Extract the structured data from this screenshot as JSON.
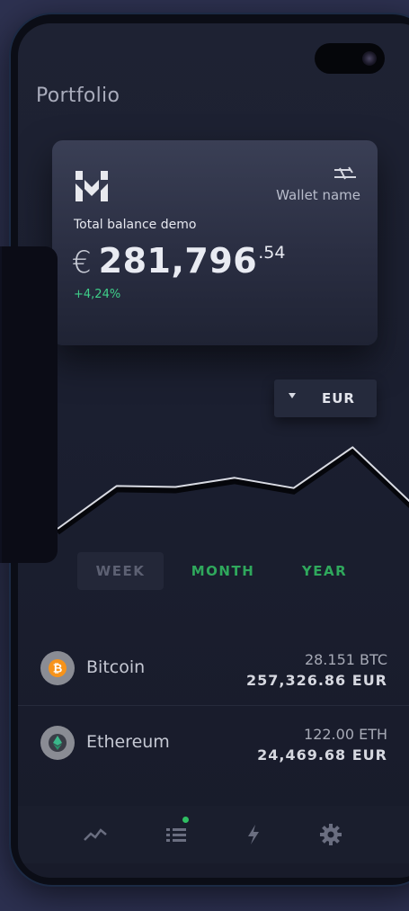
{
  "page": {
    "title": "Portfolio"
  },
  "wallet": {
    "name": "Wallet name",
    "balance_label": "Total balance demo",
    "currency_symbol": "€",
    "balance_main": "281,796",
    "balance_cents": ".54",
    "change": "+4,24%"
  },
  "currency_selector": {
    "value": "EUR"
  },
  "chart_data": {
    "type": "line",
    "x": [
      0,
      1,
      2,
      3,
      4,
      5,
      6
    ],
    "values": [
      0,
      42,
      41,
      50,
      40,
      80,
      25
    ],
    "ylim": [
      0,
      90
    ],
    "color": "#d9dbe3"
  },
  "period_tabs": [
    {
      "label": "WEEK",
      "selected": true
    },
    {
      "label": "MONTH",
      "selected": false
    },
    {
      "label": "YEAR",
      "selected": false
    }
  ],
  "assets": [
    {
      "name": "Bitcoin",
      "amount": "28.151 BTC",
      "value": "257,326.86 EUR",
      "icon": "bitcoin-icon"
    },
    {
      "name": "Ethereum",
      "amount": "122.00 ETH",
      "value": "24,469.68 EUR",
      "icon": "ethereum-icon"
    }
  ],
  "nav": [
    {
      "icon": "chart-icon"
    },
    {
      "icon": "list-icon",
      "badge": true
    },
    {
      "icon": "lightning-icon"
    },
    {
      "icon": "gear-icon"
    }
  ],
  "colors": {
    "accent_green": "#2fa85c",
    "positive": "#3fcf8a",
    "bitcoin": "#f7931a",
    "ethereum": "#3ab88a"
  }
}
